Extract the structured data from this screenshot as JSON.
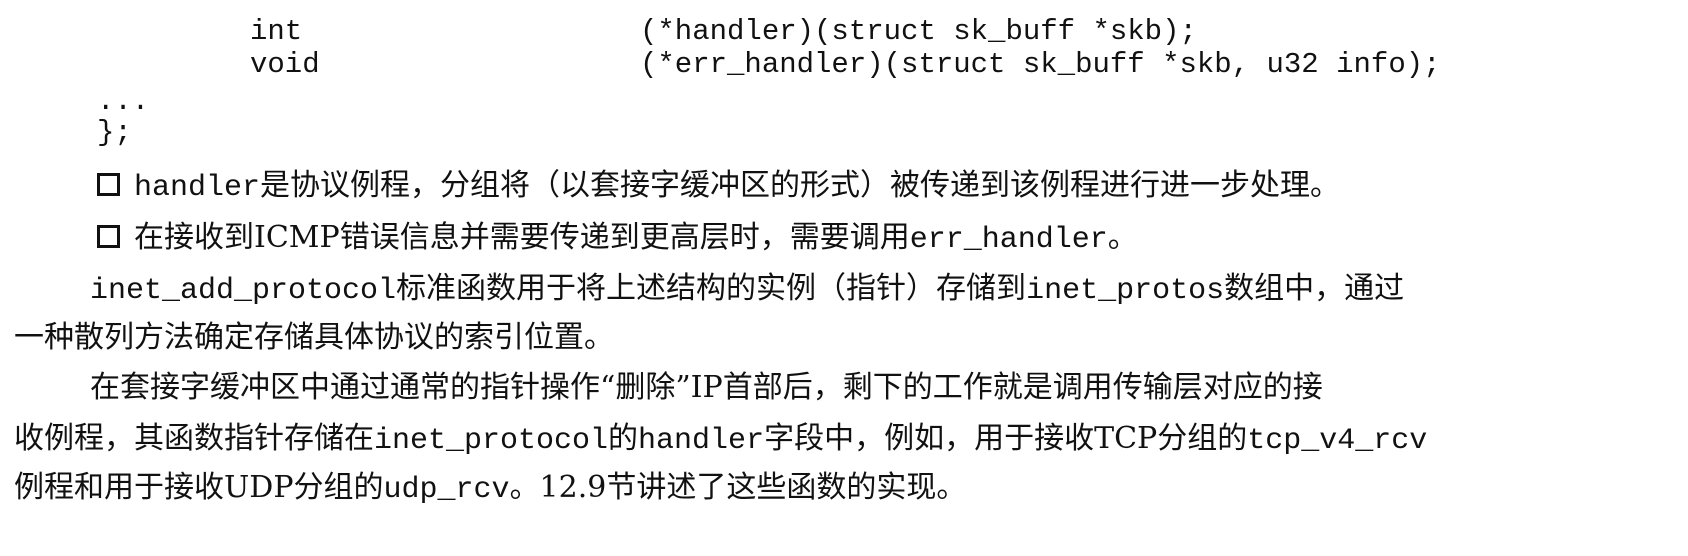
{
  "code": {
    "line1_type": "int",
    "line1_decl": "(*handler)(struct sk_buff *skb);",
    "line2_type": "void",
    "line2_decl": "(*err_handler)(struct sk_buff *skb, u32 info);",
    "ellipsis": "...",
    "closing": "};"
  },
  "bullets": [
    {
      "code": "handler",
      "text": "是协议例程，分组将（以套接字缓冲区的形式）被传递到该例程进行进一步处理。"
    },
    {
      "text_before": "在接收到ICMP错误信息并需要传递到更高层时，需要调用",
      "code": "err_handler",
      "text_after": "。"
    }
  ],
  "paragraph1": {
    "code1": "inet_add_protocol",
    "text1": "标准函数用于将上述结构的实例（指针）存储到",
    "code2": "inet_protos",
    "text2": "数组中，通过",
    "line2": "一种散列方法确定存储具体协议的索引位置。"
  },
  "paragraph2": {
    "line1": "在套接字缓冲区中通过通常的指针操作“删除”IP首部后，剩下的工作就是调用传输层对应的接",
    "line2_text1": "收例程，其函数指针存储在",
    "line2_code1": "inet_protocol",
    "line2_text2": "的",
    "line2_code2": "handler",
    "line2_text3": "字段中，例如，用于接收TCP分组的",
    "line2_code3": "tcp_v4_rcv",
    "line3_text1": "例程和用于接收UDP分组的",
    "line3_code1": "udp_rcv",
    "line3_text2": "。12.9节讲述了这些函数的实现。"
  }
}
